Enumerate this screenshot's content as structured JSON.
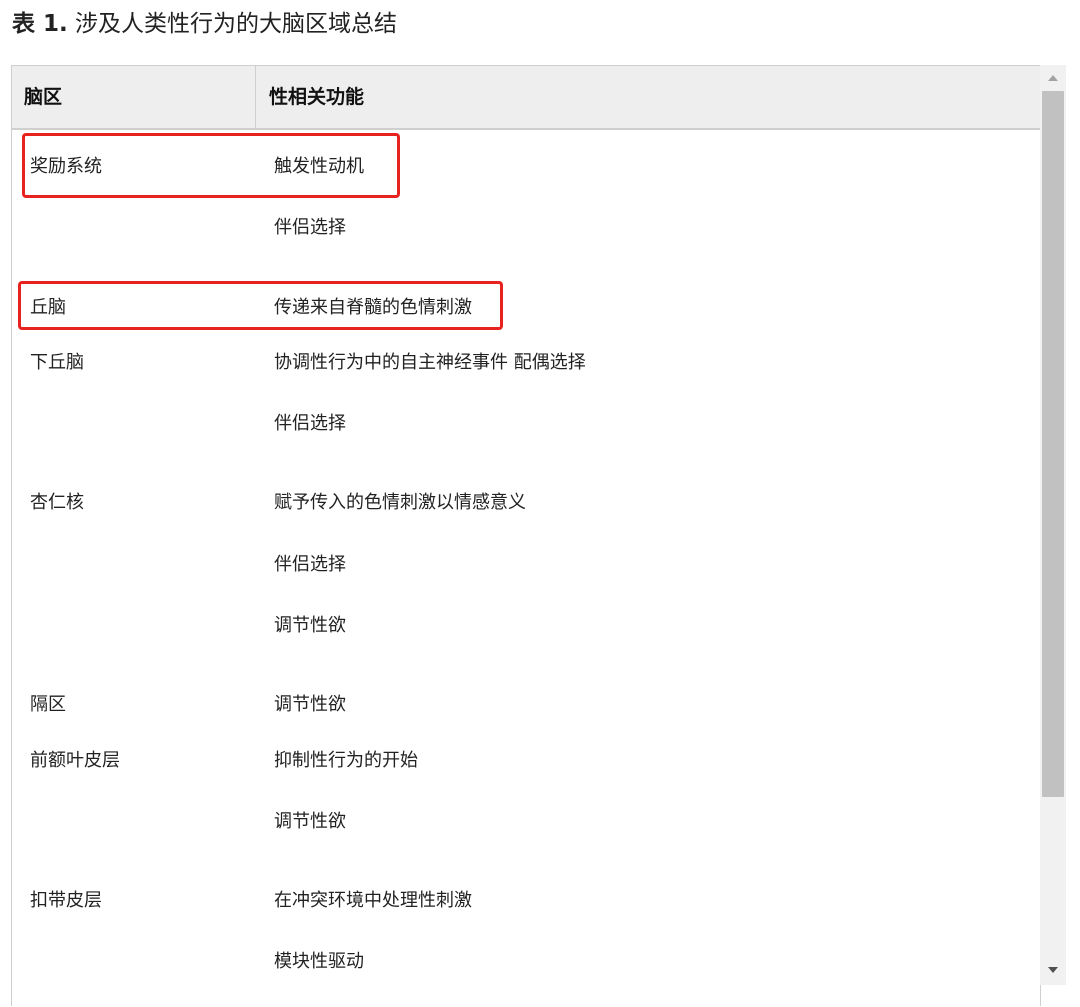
{
  "caption": {
    "label": "表 1.",
    "text": " 涉及人类性行为的大脑区域总结"
  },
  "table": {
    "headers": [
      "脑区",
      "性相关功能"
    ],
    "rows": [
      {
        "region": "奖励系统",
        "functions": [
          "触发性动机",
          "伴侣选择"
        ]
      },
      {
        "region": "丘脑",
        "functions": [
          "传递来自脊髓的色情刺激"
        ]
      },
      {
        "region": "下丘脑",
        "functions": [
          "协调性行为中的自主神经事件 配偶选择",
          "伴侣选择"
        ]
      },
      {
        "region": "杏仁核",
        "functions": [
          "赋予传入的色情刺激以情感意义",
          "伴侣选择",
          "调节性欲"
        ]
      },
      {
        "region": "隔区",
        "functions": [
          "调节性欲"
        ]
      },
      {
        "region": "前额叶皮层",
        "functions": [
          "抑制性行为的开始",
          "调节性欲"
        ]
      },
      {
        "region": "扣带皮层",
        "functions": [
          "在冲突环境中处理性刺激",
          "模块性驱动"
        ]
      }
    ]
  },
  "annotations": {
    "highlight_color": "#e8231f",
    "highlighted_rows": [
      "奖励系统",
      "丘脑"
    ]
  },
  "scrollbar": {
    "up_icon": "triangle-up-icon",
    "down_icon": "triangle-down-icon"
  }
}
